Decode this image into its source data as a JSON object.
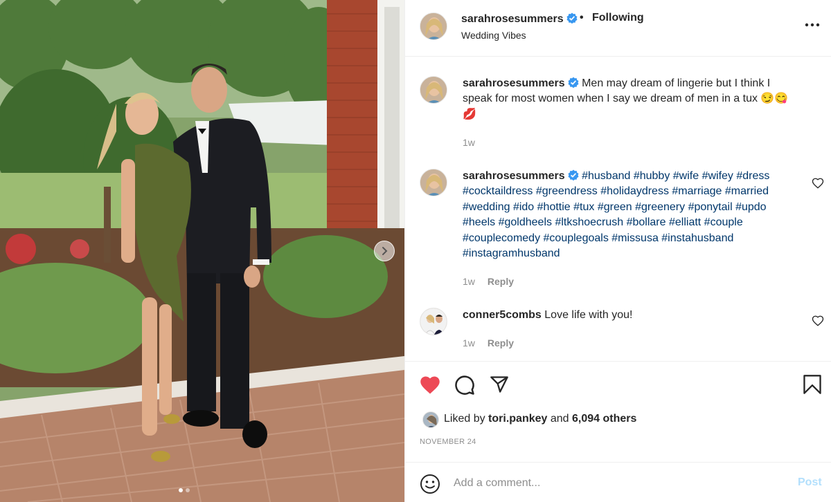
{
  "post": {
    "username": "sarahrosesummers",
    "verified": true,
    "following_label": "Following",
    "separator": "•",
    "location": "Wedding Vibes",
    "photo_description": "couple-photo",
    "carousel_dots": 2,
    "carousel_active": 0
  },
  "comments": [
    {
      "username": "sarahrosesummers",
      "text": "Men may dream of lingerie but I think I speak for most women when I say we dream of men in a tux 😏😋💋",
      "time": "1w",
      "reply_label": ""
    },
    {
      "username": "sarahrosesummers",
      "text": "#husband #hubby #wife #wifey #dress #cocktaildress #greendress #holidaydress #marriage #married #wedding #ido #hottie #tux #green #greenery #ponytail #updo #heels #goldheels #ltkshoecrush #bollare #elliatt #couple #couplecomedy #couplegoals #missusa #instahusband #instagramhusband",
      "time": "1w",
      "reply_label": "Reply"
    },
    {
      "username": "conner5combs",
      "text": "Love life with you!",
      "time": "1w",
      "reply_label": "Reply"
    }
  ],
  "likes": {
    "prefix": "Liked by",
    "user": "tori.pankey",
    "joiner": "and",
    "others": "6,094 others"
  },
  "date": "NOVEMBER 24",
  "add_comment": {
    "placeholder": "Add a comment...",
    "post_label": "Post"
  },
  "colors": {
    "heart": "#ed4956",
    "link": "#00376b",
    "verified": "#3897f0",
    "post_disabled": "#b2dffc"
  }
}
